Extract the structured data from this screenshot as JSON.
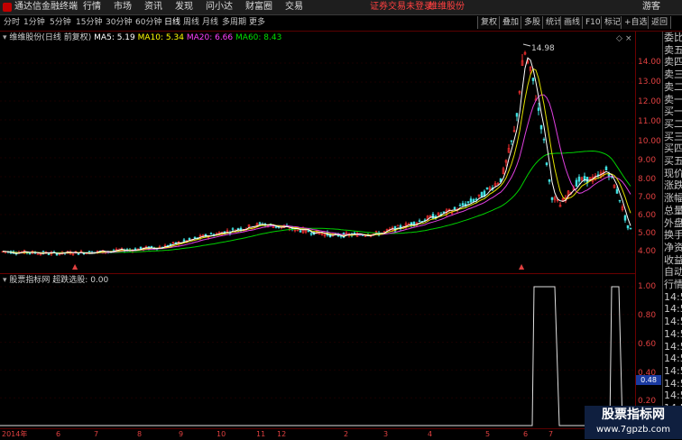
{
  "titlebar": {
    "app_title": "通达信金融终端",
    "menu": [
      "行情",
      "市场",
      "资讯",
      "发现",
      "问小达",
      "财富圈",
      "交易"
    ],
    "notice": "证券交易未登录",
    "broker": "维维股份",
    "user_link": "游客"
  },
  "period_tabs": [
    "分时",
    "1分钟",
    "5分钟",
    "15分钟",
    "30分钟",
    "60分钟",
    "日线",
    "周线",
    "月线",
    "多周期",
    "更多"
  ],
  "active_period": "日线",
  "right_tools": [
    "复权",
    "叠加",
    "多股",
    "统计",
    "画线",
    "F10",
    "标记",
    "+自选",
    "返回"
  ],
  "main_legend": {
    "stock": "维维股份(日线 前复权)",
    "ma5": "MA5: 5.19",
    "ma10": "MA10: 5.34",
    "ma20": "MA20: 6.66",
    "ma60": "MA60: 8.43"
  },
  "sub_legend": {
    "indicator": "股票指标网",
    "formula": "超跌选股: 0.00"
  },
  "y_axis_main": [
    "14.00",
    "13.00",
    "12.00",
    "11.00",
    "10.00",
    "9.00",
    "8.00",
    "7.00",
    "6.00",
    "5.00",
    "4.00"
  ],
  "y_axis_sub": [
    "1.00",
    "0.80",
    "0.60",
    "0.40",
    "0.20"
  ],
  "sub_cursor_value": "0.48",
  "peak_label": "14.98",
  "right_panel": [
    "委比",
    "卖五",
    "卖四",
    "卖三",
    "卖二",
    "卖一",
    "买一",
    "买二",
    "买三",
    "买四",
    "买五",
    "现价",
    "涨跌",
    "涨幅",
    "总量",
    "外盘",
    "换手",
    "净资",
    "收益",
    "自动",
    "行情",
    "14:5",
    "14:5",
    "14:5",
    "14:5",
    "14:5",
    "14:5",
    "14:5",
    "14:5",
    "14:5",
    "14:5",
    "14:5"
  ],
  "time_axis": [
    "2014年",
    "6",
    "7",
    "8",
    "9",
    "10",
    "11",
    "12",
    "2",
    "3",
    "4",
    "5",
    "6",
    "7",
    "8"
  ],
  "watermark": {
    "line1": "股票指标网",
    "line2": "www.7gpzb.com"
  },
  "colors": {
    "ma5": "#ffffff",
    "ma10": "#ffff00",
    "ma20": "#ff40ff",
    "ma60": "#00e000",
    "up": "#ff3030",
    "down": "#40e0e0",
    "axis": "#e04040"
  }
}
